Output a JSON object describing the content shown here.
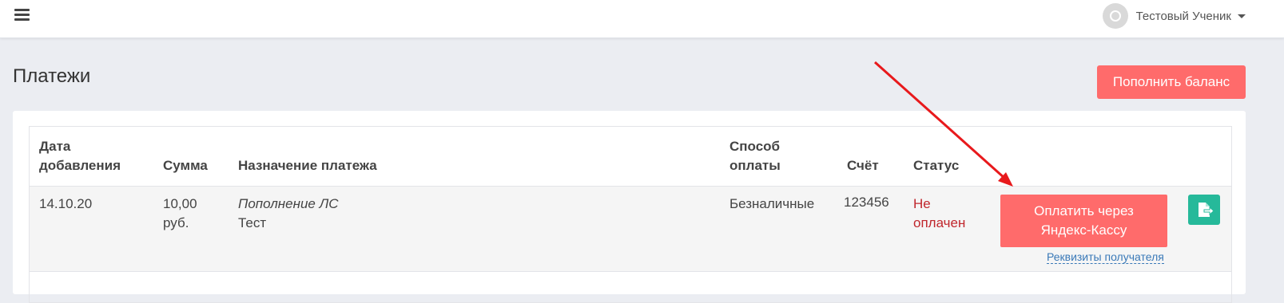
{
  "header": {
    "menu_icon": "hamburger-icon",
    "user_name": "Тестовый Ученик",
    "avatar_icon": "user-avatar-icon",
    "dropdown_icon": "caret-down-icon"
  },
  "page": {
    "title": "Платежи",
    "topup_button": "Пополнить баланс"
  },
  "table": {
    "columns": {
      "date_line1": "Дата",
      "date_line2": "добавления",
      "amount": "Сумма",
      "purpose": "Назначение платежа",
      "method_line1": "Способ",
      "method_line2": "оплаты",
      "invoice": "Счёт",
      "status": "Статус"
    },
    "rows": [
      {
        "date": "14.10.20",
        "amount_line1": "10,00",
        "amount_line2": "руб.",
        "purpose_title": "Пополнение ЛС",
        "purpose_text": "Тест",
        "method": "Безналичные",
        "invoice": "123456",
        "status_line1": "Не",
        "status_line2": "оплачен",
        "pay_button": "Оплатить через Яндекс-Кассу",
        "requisites_link": "Реквизиты получателя",
        "export_icon": "file-export-icon"
      }
    ]
  },
  "colors": {
    "accent": "#ff6b6b",
    "teal": "#26b99a",
    "status_unpaid": "#c0272d",
    "link": "#3a79b8",
    "annotation_arrow": "#e8191c"
  }
}
